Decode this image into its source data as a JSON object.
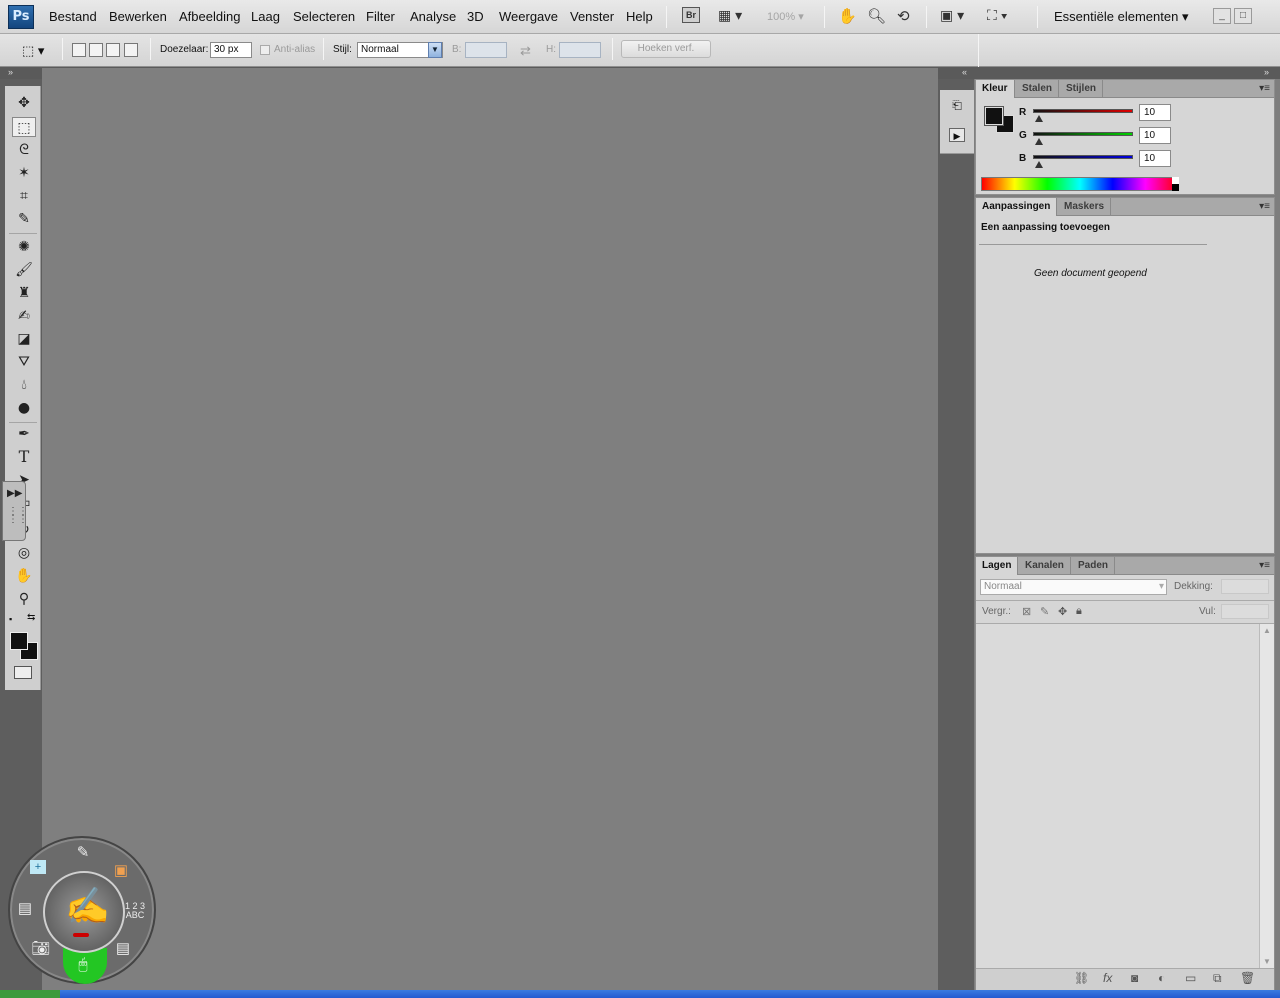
{
  "app": {
    "logo": "Ps",
    "menu": [
      "Bestand",
      "Bewerken",
      "Afbeelding",
      "Laag",
      "Selecteren",
      "Filter",
      "Analyse",
      "3D",
      "Weergave",
      "Venster",
      "Help"
    ],
    "bridge_icon": "Br",
    "zoom": "100%",
    "workspace": "Essentiële elementen",
    "window_controls": [
      "_",
      "□"
    ]
  },
  "options": {
    "feather_label": "Doezelaar:",
    "feather_value": "30 px",
    "antialias_label": "Anti-alias",
    "style_label": "Stijl:",
    "style_value": "Normaal",
    "width_label": "B:",
    "height_label": "H:",
    "refine_button": "Hoeken verf."
  },
  "color_panel": {
    "tabs": [
      "Kleur",
      "Stalen",
      "Stijlen"
    ],
    "channels": [
      {
        "label": "R",
        "value": "10",
        "color": "#d00000"
      },
      {
        "label": "G",
        "value": "10",
        "color": "#00c000"
      },
      {
        "label": "B",
        "value": "10",
        "color": "#0000d0"
      }
    ]
  },
  "adjustments_panel": {
    "tabs": [
      "Aanpassingen",
      "Maskers"
    ],
    "heading": "Een aanpassing toevoegen",
    "empty_message": "Geen document geopend"
  },
  "layers_panel": {
    "tabs": [
      "Lagen",
      "Kanalen",
      "Paden"
    ],
    "blend_mode": "Normaal",
    "opacity_label": "Dekking:",
    "lock_label": "Vergr.:",
    "fill_label": "Vul:",
    "footer_icons": [
      "link-icon",
      "fx-icon",
      "mask-icon",
      "adjustment-icon",
      "group-icon",
      "new-layer-icon",
      "trash-icon"
    ],
    "fx_text": "fx"
  },
  "tools": [
    "move-tool",
    "marquee-tool",
    "lasso-tool",
    "magic-wand-tool",
    "crop-tool",
    "eyedropper-tool",
    "spot-healing-tool",
    "brush-tool",
    "clone-stamp-tool",
    "history-brush-tool",
    "eraser-tool",
    "paint-bucket-tool",
    "blur-tool",
    "dodge-tool",
    "pen-tool",
    "type-tool",
    "path-selection-tool",
    "shape-tool",
    "3d-rotate-tool",
    "3d-orbit-tool",
    "hand-tool",
    "zoom-tool"
  ],
  "type_tool_glyph": "T",
  "pen_menu": {
    "label": "1 2 3 ABC"
  },
  "colors": {
    "foreground": "#111111",
    "background": "#111111",
    "canvas": "#7f7f7f",
    "pen_accent": "#23c623"
  }
}
